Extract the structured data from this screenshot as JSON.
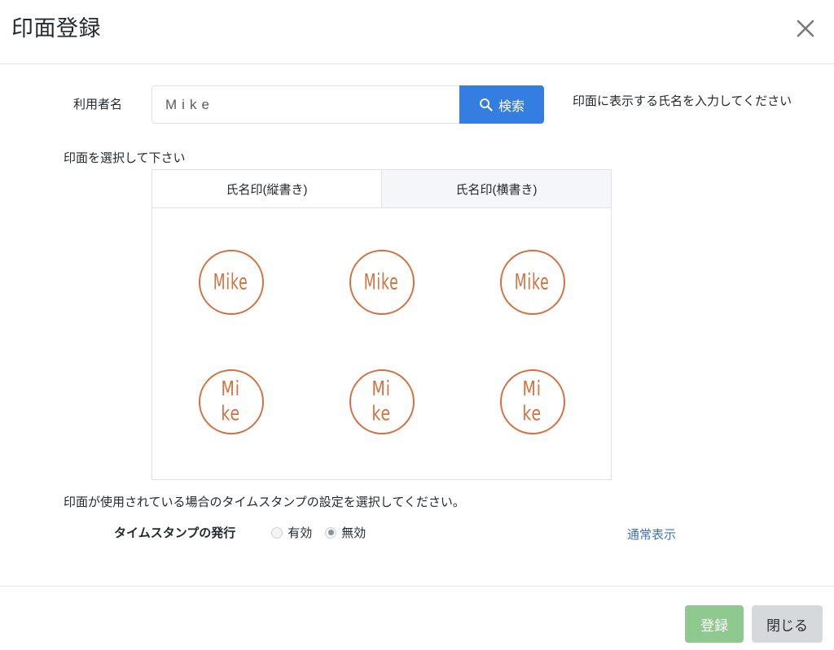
{
  "header": {
    "title": "印面登録",
    "close_icon": "close-icon"
  },
  "form": {
    "user_name_label": "利用者名",
    "user_name_value": "Mike",
    "user_name_placeholder": "",
    "search_button_label": "検索",
    "search_icon": "search-icon",
    "hint": "印面に表示する氏名を入力してください"
  },
  "seal_section": {
    "select_label": "印面を選択して下さい",
    "tabs": [
      {
        "label": "氏名印(縦書き)",
        "active": true
      },
      {
        "label": "氏名印(横書き)",
        "active": false
      }
    ],
    "seals": [
      {
        "line1": "Mike",
        "line2": ""
      },
      {
        "line1": "Mike",
        "line2": ""
      },
      {
        "line1": "Mike",
        "line2": ""
      },
      {
        "line1": "Mi",
        "line2": "ke"
      },
      {
        "line1": "Mi",
        "line2": "ke"
      },
      {
        "line1": "Mi",
        "line2": "ke"
      }
    ],
    "normal_view_link": "通常表示",
    "seal_color": "#d4703f"
  },
  "timestamp": {
    "description": "印面が使用されている場合のタイムスタンプの設定を選択してください。",
    "legend": "タイムスタンプの発行",
    "options": [
      {
        "label": "有効",
        "checked": false
      },
      {
        "label": "無効",
        "checked": true
      }
    ]
  },
  "footer": {
    "register_label": "登録",
    "close_label": "閉じる",
    "register_color": "#8fc98f",
    "close_color": "#d6d8da"
  },
  "accent": {
    "primary_blue": "#337ee0",
    "link_blue": "#3f72b7"
  }
}
